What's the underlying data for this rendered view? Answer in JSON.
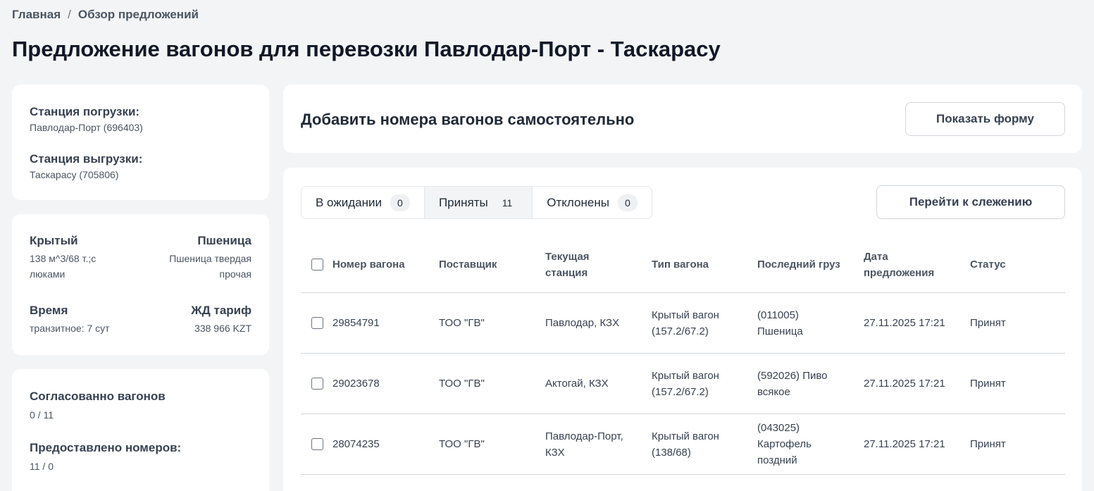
{
  "breadcrumb": {
    "home": "Главная",
    "separator": "/",
    "current": "Обзор предложений"
  },
  "page_title": "Предложение вагонов для перевозки Павлодар-Порт - Таскарасу",
  "stations": {
    "loading_label": "Станция погрузки:",
    "loading_value": "Павлодар-Порт (696403)",
    "unloading_label": "Станция выгрузки:",
    "unloading_value": "Таскарасу (705806)"
  },
  "specs": {
    "wagon_type": "Крытый",
    "wagon_desc_line1": "138 м^3/68 т.;с",
    "wagon_desc_line2": "люками",
    "cargo": "Пшеница",
    "cargo_desc_line1": "Пшеница твердая",
    "cargo_desc_line2": "прочая",
    "time_label": "Время",
    "time_value": "транзитное: 7 сут",
    "tariff_label": "ЖД тариф",
    "tariff_value": "338 966 KZT"
  },
  "counts": {
    "agreed_label": "Согласованно вагонов",
    "agreed_value": "0 / 11",
    "provided_label": "Предоставлено номеров:",
    "provided_value": "11 / 0"
  },
  "add_section": {
    "title": "Добавить номера вагонов самостоятельно",
    "show_form_button": "Показать форму"
  },
  "tabs": [
    {
      "label": "В ожидании",
      "count": "0",
      "active": false
    },
    {
      "label": "Приняты",
      "count": "11",
      "active": true
    },
    {
      "label": "Отклонены",
      "count": "0",
      "active": false
    }
  ],
  "tracking_button": "Перейти к слежению",
  "table": {
    "headers": {
      "number": "Номер вагона",
      "supplier": "Поставщик",
      "station_line1": "Текущая",
      "station_line2": "станция",
      "type": "Тип вагона",
      "cargo": "Последний груз",
      "date_line1": "Дата",
      "date_line2": "предложения",
      "status": "Статус"
    },
    "rows": [
      {
        "number": "29854791",
        "supplier": "ТОО \"ГВ\"",
        "station_line1": "Павлодар, КЗХ",
        "station_line2": "",
        "type_line1": "Крытый вагон",
        "type_line2": "(157.2/67.2)",
        "cargo_line1": "(011005)",
        "cargo_line2": "Пшеница",
        "cargo_line3": "",
        "date": "27.11.2025 17:21",
        "status": "Принят"
      },
      {
        "number": "29023678",
        "supplier": "ТОО \"ГВ\"",
        "station_line1": "Актогай, КЗХ",
        "station_line2": "",
        "type_line1": "Крытый вагон",
        "type_line2": "(157.2/67.2)",
        "cargo_line1": "(592026) Пиво",
        "cargo_line2": "всякое",
        "cargo_line3": "",
        "date": "27.11.2025 17:21",
        "status": "Принят"
      },
      {
        "number": "28074235",
        "supplier": "ТОО \"ГВ\"",
        "station_line1": "Павлодар-Порт,",
        "station_line2": "КЗХ",
        "type_line1": "Крытый вагон",
        "type_line2": "(138/68)",
        "cargo_line1": "(043025)",
        "cargo_line2": "Картофель",
        "cargo_line3": "поздний",
        "date": "27.11.2025 17:21",
        "status": "Принят"
      }
    ]
  }
}
